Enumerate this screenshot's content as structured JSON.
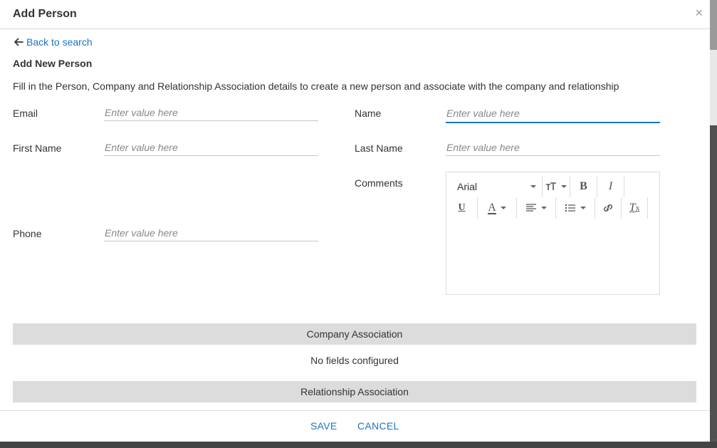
{
  "dialog": {
    "title": "Add Person",
    "close_glyph": "×",
    "back_label": "Back to search",
    "section_title": "Add New Person",
    "description": "Fill in the Person, Company and Relationship Association details to create a new person and associate with the company and relationship"
  },
  "fields": {
    "email": {
      "label": "Email",
      "placeholder": "Enter value here"
    },
    "name": {
      "label": "Name",
      "placeholder": "Enter value here"
    },
    "first_name": {
      "label": "First Name",
      "placeholder": "Enter value here"
    },
    "last_name": {
      "label": "Last Name",
      "placeholder": "Enter value here"
    },
    "comments": {
      "label": "Comments"
    },
    "phone": {
      "label": "Phone",
      "placeholder": "Enter value here"
    }
  },
  "editor": {
    "font": "Arial",
    "icons": [
      "font-size-icon",
      "bold-icon",
      "italic-icon",
      "underline-icon",
      "text-color-icon",
      "align-icon",
      "list-icon",
      "link-icon",
      "clear-format-icon"
    ]
  },
  "associations": {
    "company_title": "Company Association",
    "company_empty": "No fields configured",
    "relationship_title": "Relationship Association"
  },
  "footer": {
    "save_label": "SAVE",
    "cancel_label": "CANCEL"
  },
  "colors": {
    "accent": "#1a73c9",
    "band": "#dcdcdc"
  }
}
